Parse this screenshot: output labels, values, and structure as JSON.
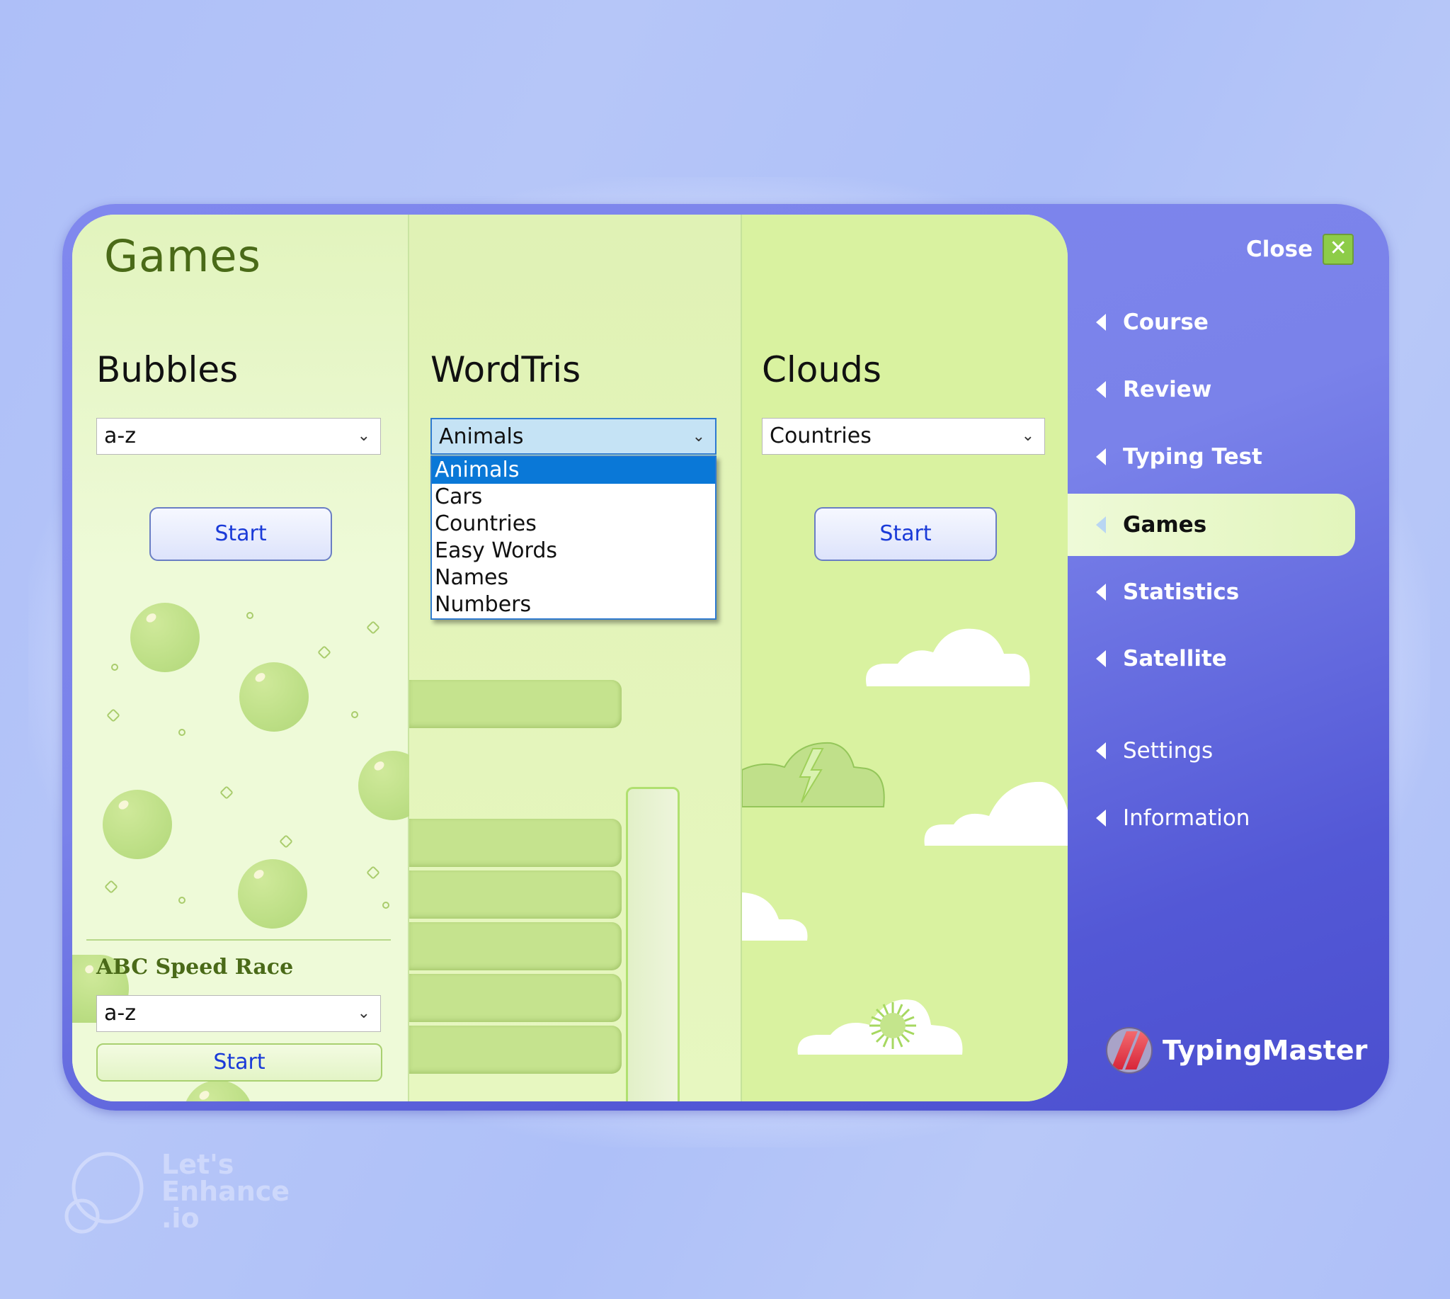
{
  "page": {
    "title": "Games"
  },
  "games": {
    "bubbles": {
      "title": "Bubbles",
      "selected": "a-z",
      "start_label": "Start"
    },
    "wordtris": {
      "title": "WordTris",
      "selected": "Animals",
      "options": [
        "Animals",
        "Cars",
        "Countries",
        "Easy Words",
        "Names",
        "Numbers"
      ],
      "highlighted_option": "Animals"
    },
    "clouds": {
      "title": "Clouds",
      "selected": "Countries",
      "start_label": "Start"
    },
    "abc_speed_race": {
      "title": "ABC Speed Race",
      "selected": "a-z",
      "start_label": "Start"
    }
  },
  "sidebar": {
    "close_label": "Close",
    "close_icon": "close-x-icon",
    "items": [
      {
        "label": "Course",
        "active": false
      },
      {
        "label": "Review",
        "active": false
      },
      {
        "label": "Typing Test",
        "active": false
      },
      {
        "label": "Games",
        "active": true
      },
      {
        "label": "Statistics",
        "active": false
      },
      {
        "label": "Satellite",
        "active": false
      },
      {
        "label": "Settings",
        "active": false
      },
      {
        "label": "Information",
        "active": false
      }
    ],
    "logo_text": "TypingMaster"
  },
  "watermark": {
    "lines": [
      "Let's",
      "Enhance",
      ".io"
    ]
  },
  "colors": {
    "sidebar_blue": "#7a82ea",
    "window_border": "#5358d6",
    "panel_green": "#d9f2a0",
    "start_text": "#1a3ad8",
    "dropdown_highlight": "#0a78d7",
    "close_green": "#8dcc48"
  }
}
